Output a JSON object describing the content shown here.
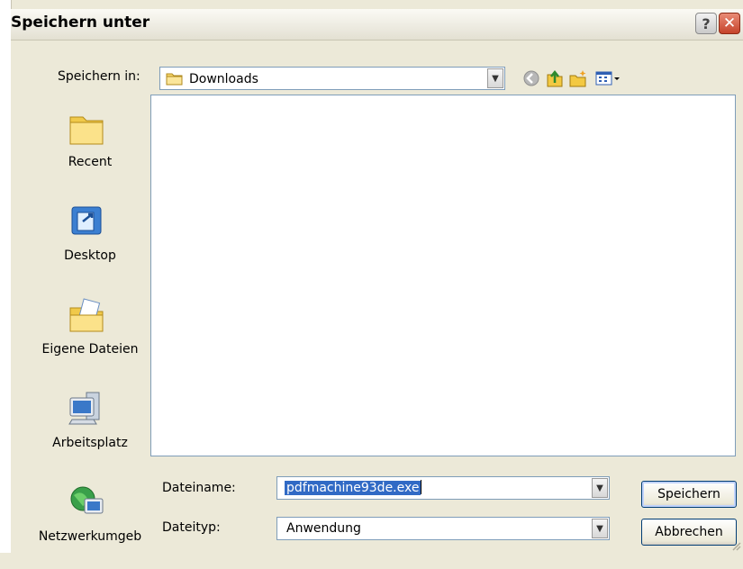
{
  "dialog": {
    "title": "Speichern unter",
    "help_symbol": "?",
    "close_symbol": "✕"
  },
  "save_in": {
    "label": "Speichern in:",
    "value": "Downloads"
  },
  "toolbar": {
    "icons": [
      "back-arrow-icon",
      "up-folder-icon",
      "new-folder-icon",
      "view-menu-icon"
    ]
  },
  "places": [
    {
      "label": "Recent",
      "icon": "recent-folder-icon"
    },
    {
      "label": "Desktop",
      "icon": "desktop-icon"
    },
    {
      "label": "Eigene Dateien",
      "icon": "my-documents-icon"
    },
    {
      "label": "Arbeitsplatz",
      "icon": "my-computer-icon"
    },
    {
      "label": "Netzwerkumgeb",
      "icon": "network-icon"
    }
  ],
  "filename": {
    "label": "Dateiname:",
    "value": "pdfmachine93de.exe"
  },
  "filetype": {
    "label": "Dateityp:",
    "value": "Anwendung"
  },
  "buttons": {
    "save": "Speichern",
    "cancel": "Abbrechen"
  },
  "colors": {
    "dialog_bg": "#ece9d8",
    "selection": "#316ac5",
    "border": "#7f9db9"
  }
}
